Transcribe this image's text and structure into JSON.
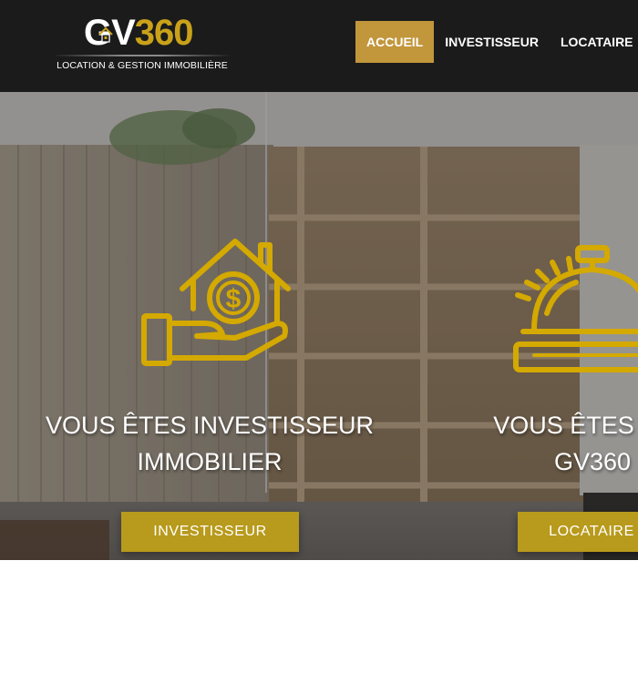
{
  "brand": {
    "logo_gv": "GV",
    "logo_number": "360",
    "tagline": "LOCATION & GESTION IMMOBILIÈRE",
    "accent_color": "#c9a21a"
  },
  "nav": {
    "items": [
      {
        "label": "ACCUEIL",
        "active": true
      },
      {
        "label": "INVESTISSEUR",
        "active": false
      },
      {
        "label": "LOCATAIRE",
        "active": false
      }
    ],
    "active_color": "#c2963b"
  },
  "hero": {
    "cards": [
      {
        "icon": "house-dollar-hand-icon",
        "title_line1": "VOUS ÊTES INVESTISSEUR",
        "title_line2": "IMMOBILIER",
        "button_label": "INVESTISSEUR"
      },
      {
        "icon": "service-bell-icon",
        "title_line1": "VOUS ÊTES LOC",
        "title_line2": "GV360",
        "button_label": "LOCATAIRE"
      }
    ],
    "icon_color": "#d4a900",
    "button_color": "#b89a1c"
  }
}
